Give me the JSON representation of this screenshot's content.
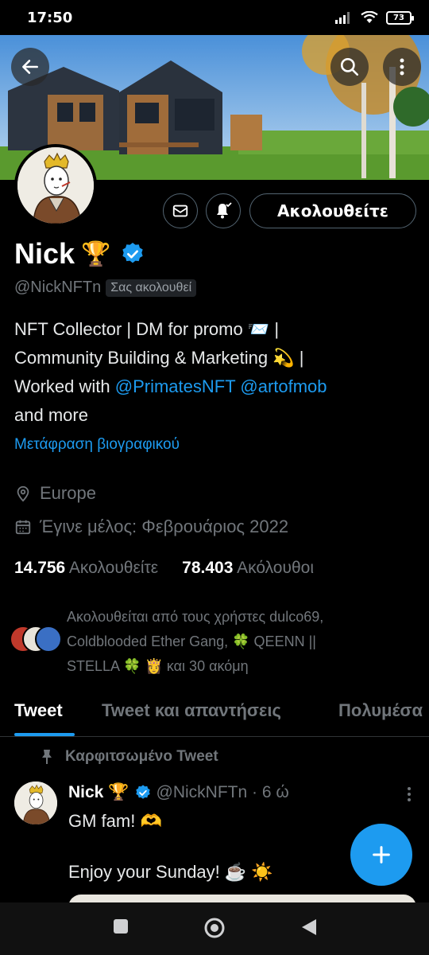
{
  "status_bar": {
    "time": "17:50",
    "battery": "73",
    "icons": [
      "signal-icon",
      "wifi-icon",
      "battery-icon"
    ]
  },
  "header": {
    "back_icon": "arrow-left-icon",
    "search_icon": "search-icon",
    "more_icon": "more-vertical-icon"
  },
  "profile": {
    "name": "Nick",
    "name_emoji": "🏆",
    "verified_icon": "verified-badge-icon",
    "handle": "@NickNFTn",
    "follows_you": "Σας ακολουθεί",
    "message_icon": "envelope-icon",
    "notify_icon": "bell-check-icon",
    "follow_button": "Ακολουθείτε",
    "bio": {
      "line1": "NFT Collector | DM for promo 📨 |",
      "line2": "Community Building & Marketing 💫  |",
      "line3_prefix": "Worked with ",
      "mention1": "@PrimatesNFT",
      "mention2": "@artofmob",
      "line4": "and more"
    },
    "translate_bio": "Μετάφραση βιογραφικού",
    "location": "Europe",
    "joined": "Έγινε μέλος: Φεβρουάριος 2022",
    "following_count": "14.756",
    "following_label": "Ακολουθείτε",
    "followers_count": "78.403",
    "followers_label": "Ακόλουθοι",
    "followed_by": {
      "line1": "Ακολουθείται από τους χρήστες dulco69,",
      "line2": "Coldblooded Ether Gang, 🍀 QEENN ||",
      "line3": "STELLA 🍀 👸  και 30 ακόμη"
    }
  },
  "tabs": [
    "Tweet",
    "Tweet και απαντήσεις",
    "Πολυμέσα"
  ],
  "pinned_label": "Καρφιτσωμένο Tweet",
  "tweet": {
    "name": "Nick",
    "name_emoji": "🏆",
    "handle_time": "@NickNFTn · 6 ώ",
    "text": "GM fam!  🫶\n\nEnjoy your Sunday! ☕ ☀️"
  },
  "fab_icon": "plus-icon",
  "navbar": [
    "square-recent-icon",
    "circle-home-icon",
    "triangle-back-icon"
  ]
}
